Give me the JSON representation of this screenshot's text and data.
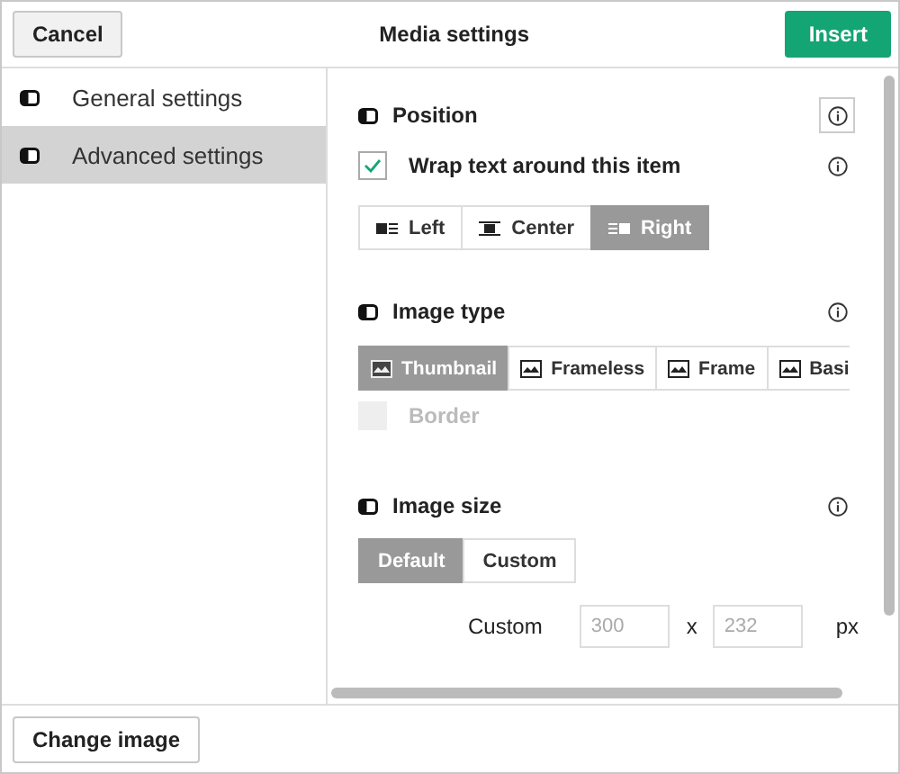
{
  "header": {
    "cancel": "Cancel",
    "title": "Media settings",
    "insert": "Insert"
  },
  "sidebar": {
    "items": [
      {
        "label": "General settings",
        "selected": false
      },
      {
        "label": "Advanced settings",
        "selected": true
      }
    ]
  },
  "position": {
    "title": "Position",
    "wrap": {
      "label": "Wrap text around this item",
      "checked": true
    },
    "alignments": [
      {
        "label": "Left",
        "kind": "left",
        "selected": false
      },
      {
        "label": "Center",
        "kind": "center",
        "selected": false
      },
      {
        "label": "Right",
        "kind": "right",
        "selected": true
      }
    ]
  },
  "image_type": {
    "title": "Image type",
    "types": [
      {
        "label": "Thumbnail",
        "selected": true
      },
      {
        "label": "Frameless",
        "selected": false
      },
      {
        "label": "Frame",
        "selected": false
      },
      {
        "label": "Basi",
        "selected": false
      }
    ],
    "border": {
      "label": "Border",
      "checked": false,
      "disabled": true
    }
  },
  "image_size": {
    "title": "Image size",
    "modes": [
      {
        "label": "Default",
        "selected": true
      },
      {
        "label": "Custom",
        "selected": false
      }
    ],
    "custom": {
      "label": "Custom",
      "width_placeholder": "300",
      "separator": "x",
      "height_placeholder": "232",
      "unit": "px"
    }
  },
  "footer": {
    "change_image": "Change image"
  }
}
